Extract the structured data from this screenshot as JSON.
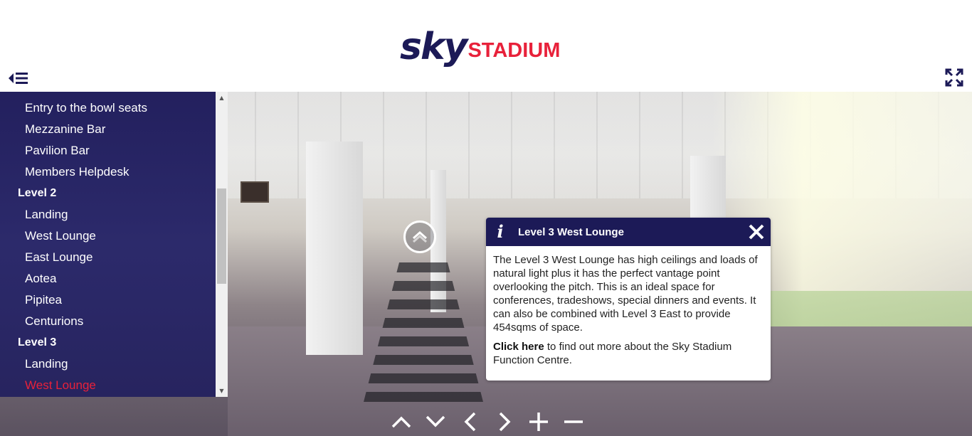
{
  "logo": {
    "brand": "sky",
    "name": "STADIUM",
    "colors": {
      "navy": "#1c1a57",
      "red": "#e8213a"
    }
  },
  "toolbar": {
    "menu_icon": "menu-collapse-icon",
    "fullscreen_icon": "fullscreen-icon"
  },
  "sidebar": {
    "items": [
      {
        "label": "Entry to the bowl seats",
        "type": "item"
      },
      {
        "label": "Mezzanine Bar",
        "type": "item"
      },
      {
        "label": "Pavilion Bar",
        "type": "item"
      },
      {
        "label": "Members Helpdesk",
        "type": "item"
      },
      {
        "label": "Level 2",
        "type": "heading"
      },
      {
        "label": "Landing",
        "type": "item"
      },
      {
        "label": "West Lounge",
        "type": "item"
      },
      {
        "label": "East Lounge",
        "type": "item"
      },
      {
        "label": "Aotea",
        "type": "item"
      },
      {
        "label": "Pipitea",
        "type": "item"
      },
      {
        "label": "Centurions",
        "type": "item"
      },
      {
        "label": "Level 3",
        "type": "heading"
      },
      {
        "label": "Landing",
        "type": "item"
      },
      {
        "label": "West Lounge",
        "type": "item",
        "active": true
      }
    ]
  },
  "info": {
    "icon": "info-icon",
    "title": "Level 3 West Lounge",
    "body": "The Level 3 West Lounge has high ceilings and loads of natural light plus it has the perfect vantage point overlooking the pitch. This is an ideal space for conferences, tradeshows, special dinners and events. It can also be combined with Level 3 East to provide 454sqms of space.",
    "link_label": "Click here",
    "link_tail": " to find out more about the Sky Stadium Function Centre."
  },
  "controls": [
    "up",
    "down",
    "left",
    "right",
    "zoom-in",
    "zoom-out"
  ]
}
